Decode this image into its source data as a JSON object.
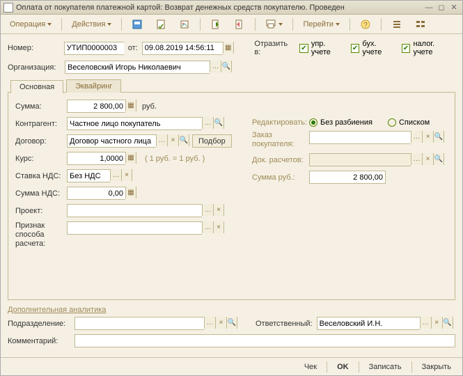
{
  "window": {
    "title": "Оплата от покупателя платежной картой: Возврат денежных средств покупателю. Проведен"
  },
  "toolbar": {
    "operation": "Операция",
    "actions": "Действия",
    "go": "Перейти"
  },
  "header": {
    "number_lbl": "Номер:",
    "number": "УТИП0000003",
    "from_lbl": "от:",
    "date": "09.08.2019 14:56:11",
    "reflect_lbl": "Отразить в:",
    "chk1": "упр. учете",
    "chk2": "бух. учете",
    "chk3": "налог. учете",
    "org_lbl": "Организация:",
    "org": "Веселовский Игорь Николаевич"
  },
  "tabs": {
    "main": "Основная",
    "acquiring": "Эквайринг"
  },
  "main": {
    "sum_lbl": "Сумма:",
    "sum": "2 800,00",
    "sum_currency": "руб.",
    "contr_lbl": "Контрагент:",
    "contr": "Частное лицо покупатель",
    "dogovor_lbl": "Договор:",
    "dogovor": "Договор частного лица",
    "podbor": "Подбор",
    "kurs_lbl": "Курс:",
    "kurs": "1,0000",
    "kurs_hint": "( 1 руб. = 1 руб. )",
    "nds_rate_lbl": "Ставка НДС:",
    "nds_rate": "Без НДС",
    "nds_sum_lbl": "Сумма НДС:",
    "nds_sum": "0,00",
    "project_lbl": "Проект:",
    "method_lbl": "Признак способа расчета:"
  },
  "rightcol": {
    "edit_lbl": "Редактировать:",
    "radio1": "Без разбиения",
    "radio2": "Списком",
    "order_lbl": "Заказ покупателя:",
    "docs_lbl": "Док. расчетов:",
    "sumrub_lbl": "Сумма руб.:",
    "sumrub": "2 800,00"
  },
  "analytics": {
    "title": "Дополнительная аналитика",
    "dept_lbl": "Подразделение:",
    "resp_lbl": "Ответственный:",
    "resp": "Веселовский И.Н.",
    "comment_lbl": "Комментарий:"
  },
  "footer": {
    "check": "Чек",
    "ok": "OK",
    "write": "Записать",
    "close": "Закрыть"
  }
}
